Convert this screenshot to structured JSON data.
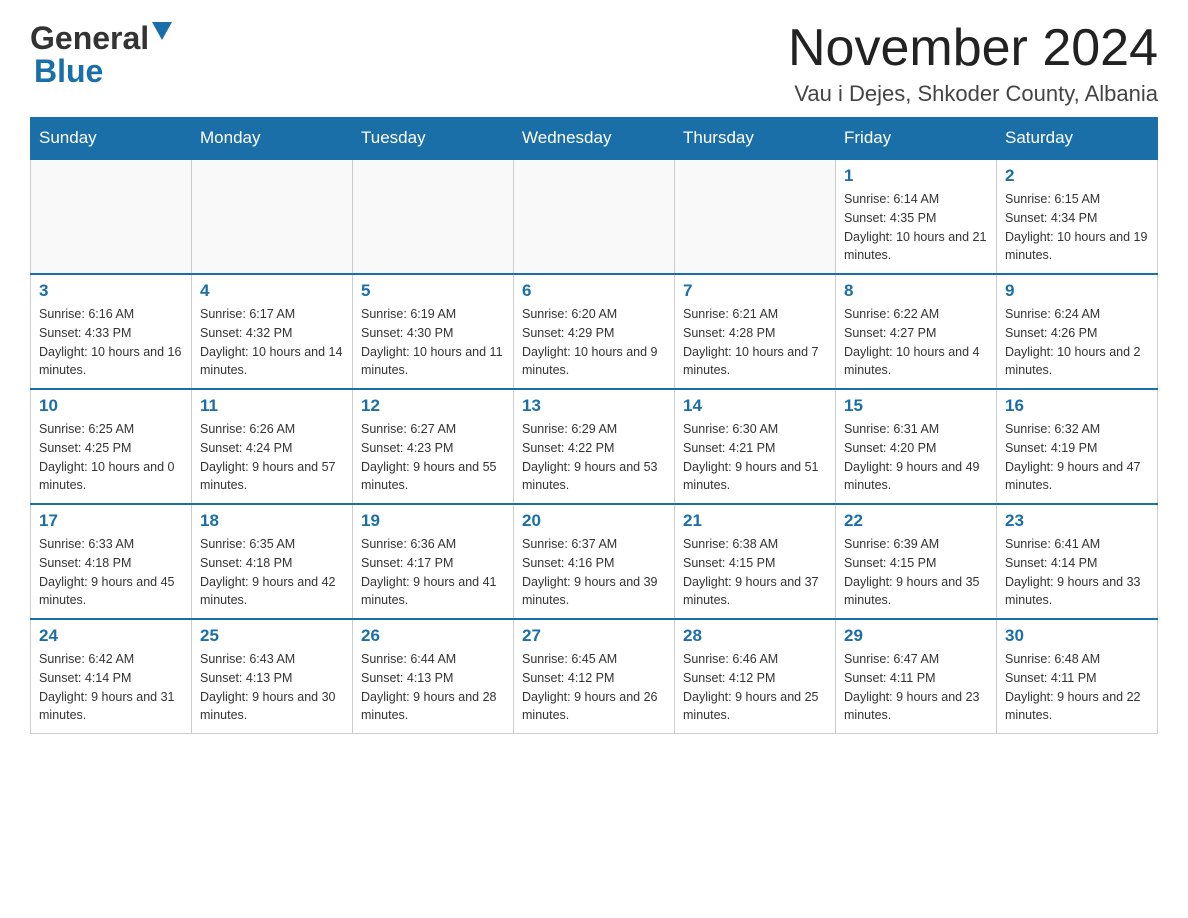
{
  "header": {
    "logo": {
      "general": "General",
      "blue": "Blue"
    },
    "title": "November 2024",
    "location": "Vau i Dejes, Shkoder County, Albania"
  },
  "calendar": {
    "days_of_week": [
      "Sunday",
      "Monday",
      "Tuesday",
      "Wednesday",
      "Thursday",
      "Friday",
      "Saturday"
    ],
    "weeks": [
      [
        {
          "day": "",
          "info": ""
        },
        {
          "day": "",
          "info": ""
        },
        {
          "day": "",
          "info": ""
        },
        {
          "day": "",
          "info": ""
        },
        {
          "day": "",
          "info": ""
        },
        {
          "day": "1",
          "info": "Sunrise: 6:14 AM\nSunset: 4:35 PM\nDaylight: 10 hours and 21 minutes."
        },
        {
          "day": "2",
          "info": "Sunrise: 6:15 AM\nSunset: 4:34 PM\nDaylight: 10 hours and 19 minutes."
        }
      ],
      [
        {
          "day": "3",
          "info": "Sunrise: 6:16 AM\nSunset: 4:33 PM\nDaylight: 10 hours and 16 minutes."
        },
        {
          "day": "4",
          "info": "Sunrise: 6:17 AM\nSunset: 4:32 PM\nDaylight: 10 hours and 14 minutes."
        },
        {
          "day": "5",
          "info": "Sunrise: 6:19 AM\nSunset: 4:30 PM\nDaylight: 10 hours and 11 minutes."
        },
        {
          "day": "6",
          "info": "Sunrise: 6:20 AM\nSunset: 4:29 PM\nDaylight: 10 hours and 9 minutes."
        },
        {
          "day": "7",
          "info": "Sunrise: 6:21 AM\nSunset: 4:28 PM\nDaylight: 10 hours and 7 minutes."
        },
        {
          "day": "8",
          "info": "Sunrise: 6:22 AM\nSunset: 4:27 PM\nDaylight: 10 hours and 4 minutes."
        },
        {
          "day": "9",
          "info": "Sunrise: 6:24 AM\nSunset: 4:26 PM\nDaylight: 10 hours and 2 minutes."
        }
      ],
      [
        {
          "day": "10",
          "info": "Sunrise: 6:25 AM\nSunset: 4:25 PM\nDaylight: 10 hours and 0 minutes."
        },
        {
          "day": "11",
          "info": "Sunrise: 6:26 AM\nSunset: 4:24 PM\nDaylight: 9 hours and 57 minutes."
        },
        {
          "day": "12",
          "info": "Sunrise: 6:27 AM\nSunset: 4:23 PM\nDaylight: 9 hours and 55 minutes."
        },
        {
          "day": "13",
          "info": "Sunrise: 6:29 AM\nSunset: 4:22 PM\nDaylight: 9 hours and 53 minutes."
        },
        {
          "day": "14",
          "info": "Sunrise: 6:30 AM\nSunset: 4:21 PM\nDaylight: 9 hours and 51 minutes."
        },
        {
          "day": "15",
          "info": "Sunrise: 6:31 AM\nSunset: 4:20 PM\nDaylight: 9 hours and 49 minutes."
        },
        {
          "day": "16",
          "info": "Sunrise: 6:32 AM\nSunset: 4:19 PM\nDaylight: 9 hours and 47 minutes."
        }
      ],
      [
        {
          "day": "17",
          "info": "Sunrise: 6:33 AM\nSunset: 4:18 PM\nDaylight: 9 hours and 45 minutes."
        },
        {
          "day": "18",
          "info": "Sunrise: 6:35 AM\nSunset: 4:18 PM\nDaylight: 9 hours and 42 minutes."
        },
        {
          "day": "19",
          "info": "Sunrise: 6:36 AM\nSunset: 4:17 PM\nDaylight: 9 hours and 41 minutes."
        },
        {
          "day": "20",
          "info": "Sunrise: 6:37 AM\nSunset: 4:16 PM\nDaylight: 9 hours and 39 minutes."
        },
        {
          "day": "21",
          "info": "Sunrise: 6:38 AM\nSunset: 4:15 PM\nDaylight: 9 hours and 37 minutes."
        },
        {
          "day": "22",
          "info": "Sunrise: 6:39 AM\nSunset: 4:15 PM\nDaylight: 9 hours and 35 minutes."
        },
        {
          "day": "23",
          "info": "Sunrise: 6:41 AM\nSunset: 4:14 PM\nDaylight: 9 hours and 33 minutes."
        }
      ],
      [
        {
          "day": "24",
          "info": "Sunrise: 6:42 AM\nSunset: 4:14 PM\nDaylight: 9 hours and 31 minutes."
        },
        {
          "day": "25",
          "info": "Sunrise: 6:43 AM\nSunset: 4:13 PM\nDaylight: 9 hours and 30 minutes."
        },
        {
          "day": "26",
          "info": "Sunrise: 6:44 AM\nSunset: 4:13 PM\nDaylight: 9 hours and 28 minutes."
        },
        {
          "day": "27",
          "info": "Sunrise: 6:45 AM\nSunset: 4:12 PM\nDaylight: 9 hours and 26 minutes."
        },
        {
          "day": "28",
          "info": "Sunrise: 6:46 AM\nSunset: 4:12 PM\nDaylight: 9 hours and 25 minutes."
        },
        {
          "day": "29",
          "info": "Sunrise: 6:47 AM\nSunset: 4:11 PM\nDaylight: 9 hours and 23 minutes."
        },
        {
          "day": "30",
          "info": "Sunrise: 6:48 AM\nSunset: 4:11 PM\nDaylight: 9 hours and 22 minutes."
        }
      ]
    ]
  }
}
